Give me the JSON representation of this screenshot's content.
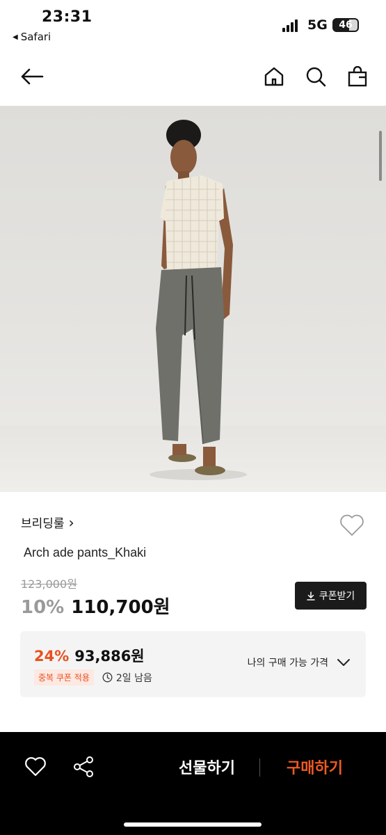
{
  "status_bar": {
    "time": "23:31",
    "back_app": "Safari",
    "network": "5G",
    "battery": "46"
  },
  "nav": {
    "back_icon": "arrow-left-icon",
    "home_icon": "home-icon",
    "search_icon": "search-icon",
    "bag_icon": "shopping-bag-icon"
  },
  "product": {
    "brand": "브리딩룰",
    "brand_chevron": "›",
    "name": "Arch ade pants_Khaki",
    "original_price": "123,000원",
    "discount": "10%",
    "price": "110,700원",
    "coupon_button": "쿠폰받기",
    "wishlist_icon": "heart-outline-icon"
  },
  "best_price": {
    "discount": "24%",
    "price": "93,886원",
    "dup_coupon_tag": "중복 쿠폰 적용",
    "timer": "2일 남음",
    "my_price_label": "나의 구매 가능 가격",
    "accent_color": "#e8511f"
  },
  "bottom_bar": {
    "like_icon": "heart-icon",
    "share_icon": "share-icon",
    "gift_button": "선물하기",
    "buy_button": "구매하기",
    "buy_color": "#f05a23"
  }
}
